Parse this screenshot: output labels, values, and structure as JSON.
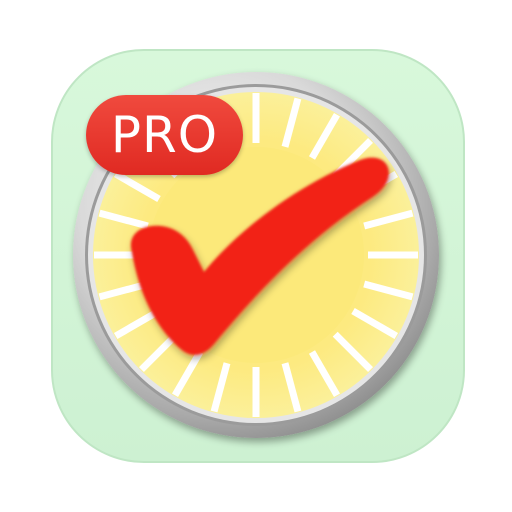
{
  "app_icon": {
    "badge_text": "PRO",
    "icon_name": "checkmark-dial-icon",
    "colors": {
      "background": "#d4f7d8",
      "background_border": "#b9e3bf",
      "dial_face": "#fcef85",
      "dial_center": "#fce97a",
      "bezel": "#c8c8c8",
      "checkmark": "#f02412",
      "badge": "#e8332a"
    }
  }
}
